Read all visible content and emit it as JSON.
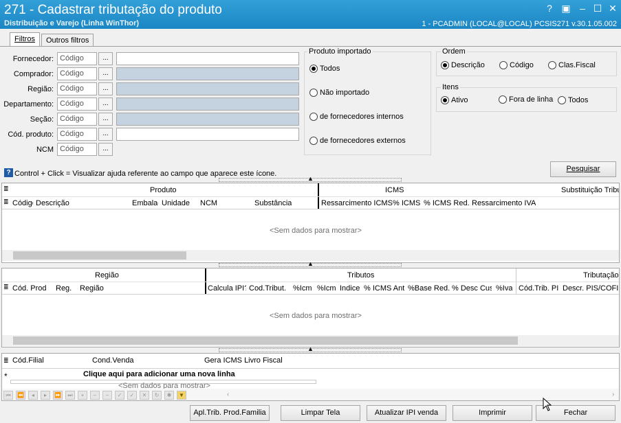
{
  "window": {
    "title": "271 - Cadastrar tributação do produto",
    "subtitle": "Distribuição e Varejo (Linha WinThor)",
    "status_info": "1 - PCADMIN (LOCAL@LOCAL)    PCSIS271  v.30.1.05.002",
    "controls": [
      "?",
      "▣",
      "–",
      "☐",
      "✕"
    ]
  },
  "tabs": [
    {
      "label": "Filtros"
    },
    {
      "label": "Outros filtros"
    }
  ],
  "filters": [
    {
      "label": "Fornecedor:",
      "placeholder": "Código"
    },
    {
      "label": "Comprador:",
      "placeholder": "Código"
    },
    {
      "label": "Região:",
      "placeholder": "Código"
    },
    {
      "label": "Departamento:",
      "placeholder": "Código"
    },
    {
      "label": "Seção:",
      "placeholder": "Código"
    },
    {
      "label": "Cód. produto:",
      "placeholder": "Código"
    },
    {
      "label": "NCM",
      "placeholder": "Código"
    }
  ],
  "lookup_button_label": "...",
  "produto_importado": {
    "title": "Produto importado",
    "options": [
      "Todos",
      "Não importado",
      "de fornecedores internos",
      "de fornecedores externos"
    ],
    "selected": "Todos"
  },
  "ordem": {
    "title": "Ordem",
    "options": [
      "Descrição",
      "Código",
      "Clas.Fiscal"
    ],
    "selected": "Descrição"
  },
  "itens": {
    "title": "Itens",
    "options": [
      "Ativo",
      "Fora de linha",
      "Todos"
    ],
    "selected": "Ativo"
  },
  "help_text": "Control + Click = Visualizar ajuda referente ao campo que aparece este ícone.",
  "search_button": "Pesquisar",
  "grid1": {
    "bands": [
      "Produto",
      "ICMS",
      "Substituição Tribu"
    ],
    "columns": [
      "Código",
      "Descrição",
      "Embalag",
      "Unidade",
      "NCM",
      "Substância",
      "Ressarcimento ICMS",
      "% ICMS",
      "% ICMS Red.",
      "Ressarcimento IVA"
    ],
    "empty": "<Sem dados para mostrar>"
  },
  "grid2": {
    "bands": [
      "Região",
      "Tributos",
      "Tributação"
    ],
    "columns": [
      "Cód. Prod",
      "Reg.",
      "Região",
      "Calcula IPI?",
      "Cod.Tribut.",
      "%Icm",
      "%Icm",
      "Indice",
      "% ICMS Ant",
      "%Base Red.",
      "% Desc Cus",
      "%Iva",
      "Cód.Trib. PI",
      "Descr. PIS/COFIN"
    ],
    "empty": "<Sem dados para mostrar>"
  },
  "grid3": {
    "columns": [
      "Cód.Filial",
      "Cond.Venda",
      "Gera ICMS Livro Fiscal"
    ],
    "new_row": "Clique aqui para adicionar uma nova linha",
    "empty": "<Sem dados para mostrar>"
  },
  "footer_buttons": [
    "Apl.Trib. Prod.Familia",
    "Limpar Tela",
    "Atualizar IPI venda",
    "Imprimir",
    "Fechar"
  ]
}
